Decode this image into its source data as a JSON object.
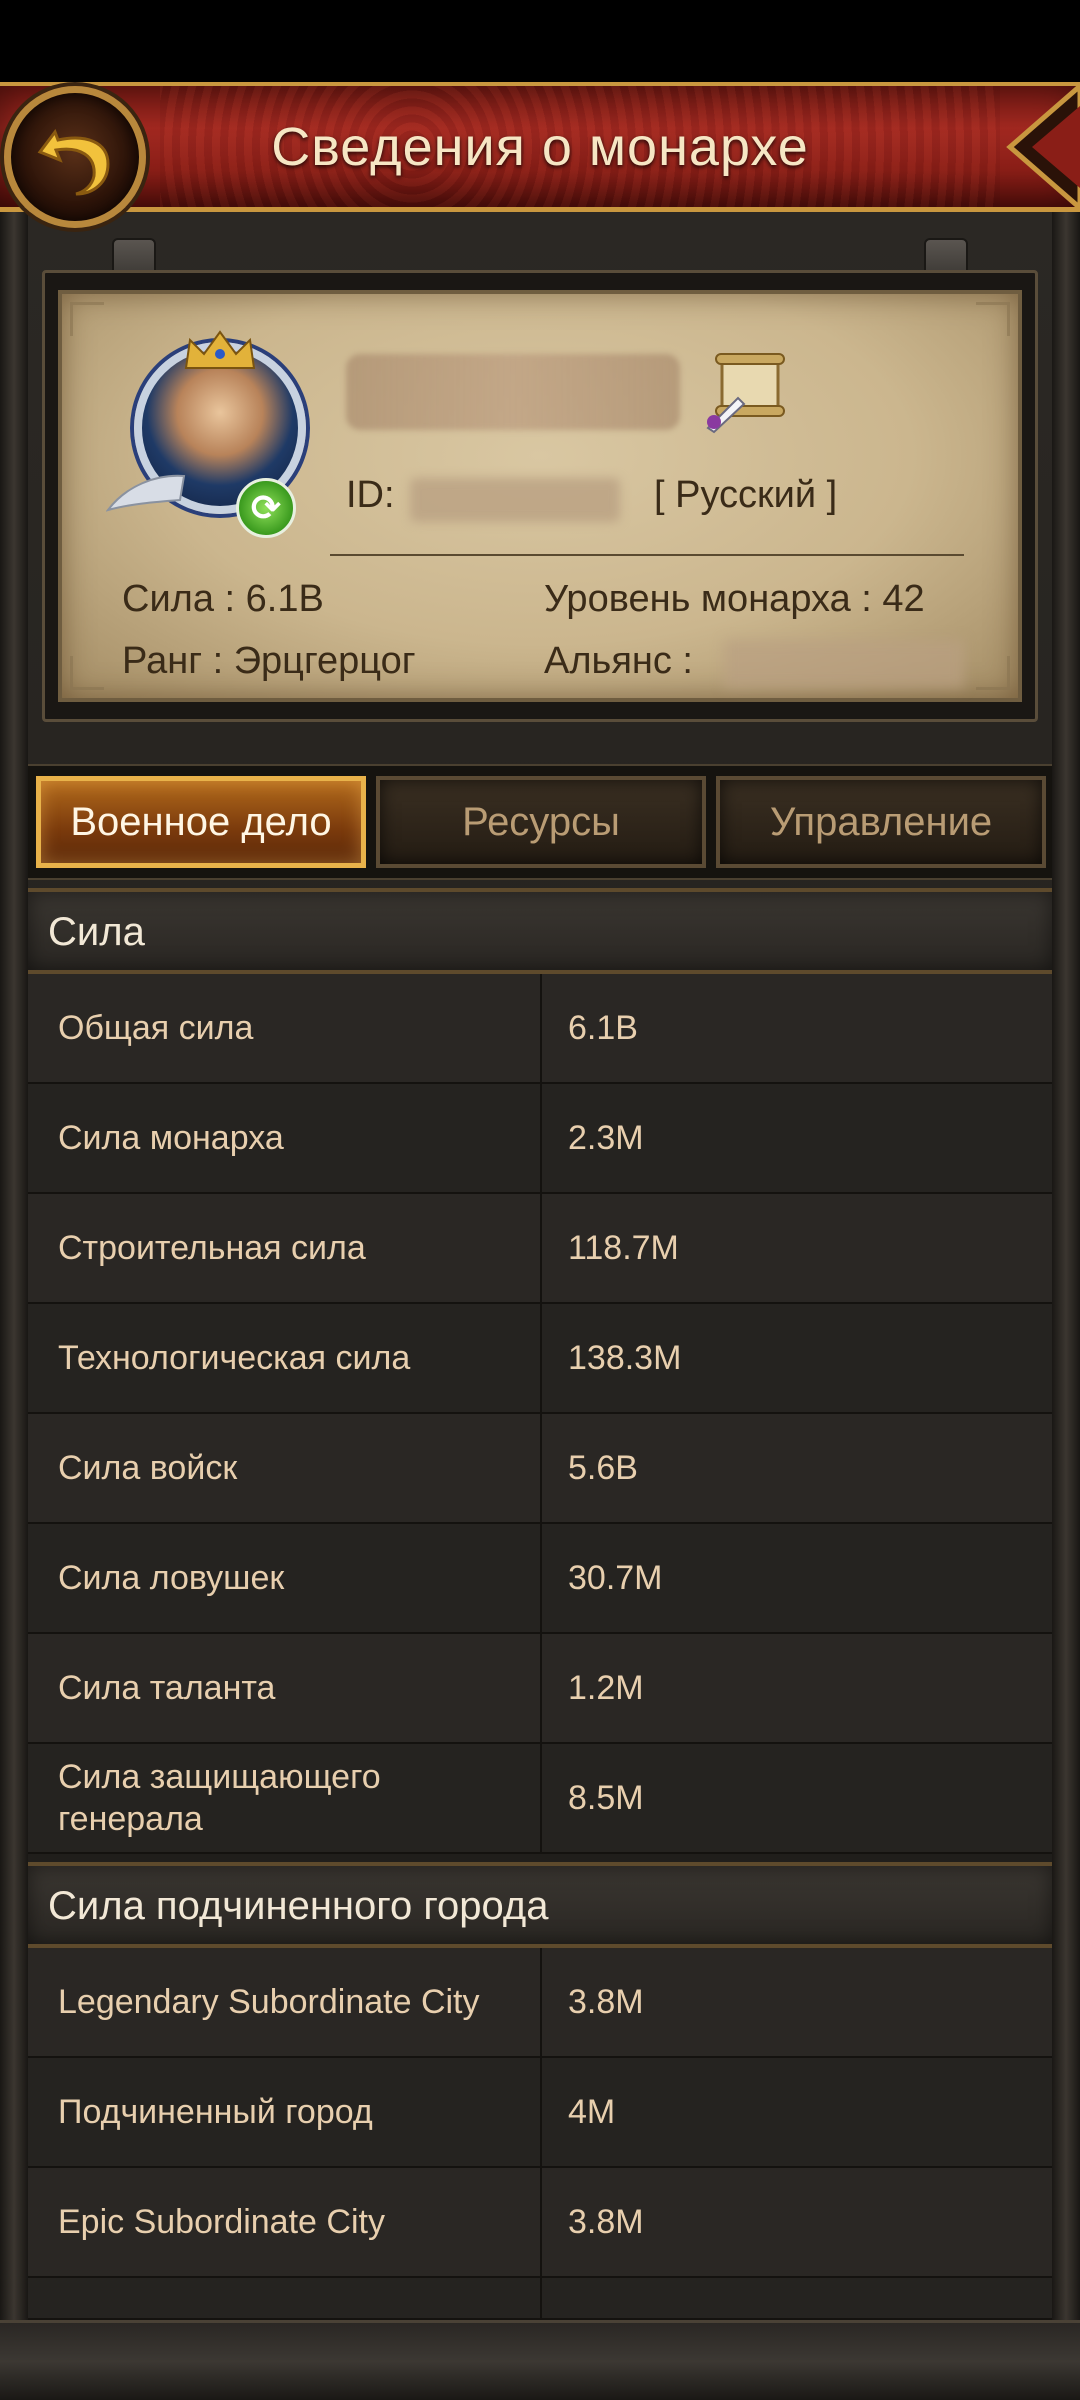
{
  "header": {
    "title": "Сведения о монархе"
  },
  "profile": {
    "id_label": "ID:",
    "language": "[ Русский ]",
    "power_text": "Сила : 6.1B",
    "level_text": "Уровень монарха : 42",
    "rank_text": "Ранг : Эрцгерцог",
    "alliance_text": "Альянс :"
  },
  "tabs": [
    {
      "label": "Военное дело",
      "active": true
    },
    {
      "label": "Ресурсы",
      "active": false
    },
    {
      "label": "Управление",
      "active": false
    }
  ],
  "sections": [
    {
      "title": "Сила",
      "rows": [
        {
          "label": "Общая сила",
          "value": "6.1B"
        },
        {
          "label": "Сила монарха",
          "value": "2.3M"
        },
        {
          "label": "Строительная сила",
          "value": "118.7M"
        },
        {
          "label": "Технологическая сила",
          "value": "138.3M"
        },
        {
          "label": "Сила войск",
          "value": "5.6B"
        },
        {
          "label": "Сила ловушек",
          "value": "30.7M"
        },
        {
          "label": "Сила таланта",
          "value": "1.2M"
        },
        {
          "label": "Сила защищающего генерала",
          "value": "8.5M"
        }
      ]
    },
    {
      "title": "Сила подчиненного города",
      "rows": [
        {
          "label": "Legendary Subordinate City",
          "value": "3.8M"
        },
        {
          "label": "Подчиненный город",
          "value": "4M"
        },
        {
          "label": "Epic Subordinate City",
          "value": "3.8M"
        }
      ]
    }
  ],
  "colors": {
    "banner_red": "#a12820",
    "gold_trim": "#c9973f",
    "parchment": "#cbb68e",
    "active_tab": "#b26a1c",
    "table_text": "#e8cfae"
  },
  "icons": {
    "back": "back-arrow-icon",
    "scroll": "scroll-quill-icon",
    "avatar_badge": "refresh-icon"
  }
}
